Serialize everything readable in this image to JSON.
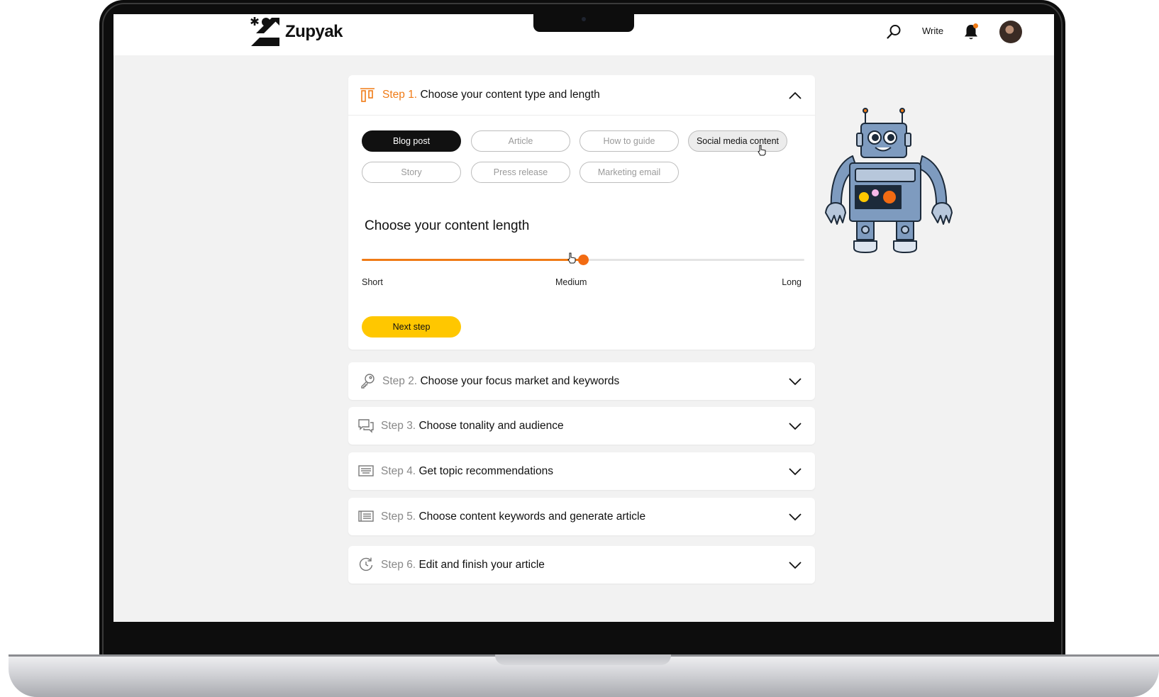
{
  "brand": {
    "name": "Zupyak"
  },
  "nav": {
    "write_label": "Write",
    "bell_dot_color": "#f07b16"
  },
  "colors": {
    "accent": "#f07b16",
    "cta": "#ffc700",
    "selected_pill": "#111111"
  },
  "step1": {
    "num": "Step 1.",
    "title": "Choose your content type and length",
    "expanded": true,
    "content_types": [
      {
        "label": "Blog post",
        "state": "selected"
      },
      {
        "label": "Article",
        "state": "default"
      },
      {
        "label": "How to guide",
        "state": "default"
      },
      {
        "label": "Social media content",
        "state": "hover"
      },
      {
        "label": "Story",
        "state": "default"
      },
      {
        "label": "Press release",
        "state": "default"
      },
      {
        "label": "Marketing email",
        "state": "default"
      }
    ],
    "length_title": "Choose your content length",
    "length_labels": [
      "Short",
      "Medium",
      "Long"
    ],
    "length_value": 0.5,
    "next_label": "Next step"
  },
  "steps": [
    {
      "num": "Step 2.",
      "title": "Choose your focus market and keywords",
      "icon": "key-icon"
    },
    {
      "num": "Step 3.",
      "title": "Choose tonality and audience",
      "icon": "chat-icon"
    },
    {
      "num": "Step 4.",
      "title": "Get topic recommendations",
      "icon": "keyboard-icon"
    },
    {
      "num": "Step 5.",
      "title": "Choose content keywords and generate article",
      "icon": "list-icon"
    },
    {
      "num": "Step 6.",
      "title": "Edit and finish your article",
      "icon": "refresh-icon"
    }
  ]
}
